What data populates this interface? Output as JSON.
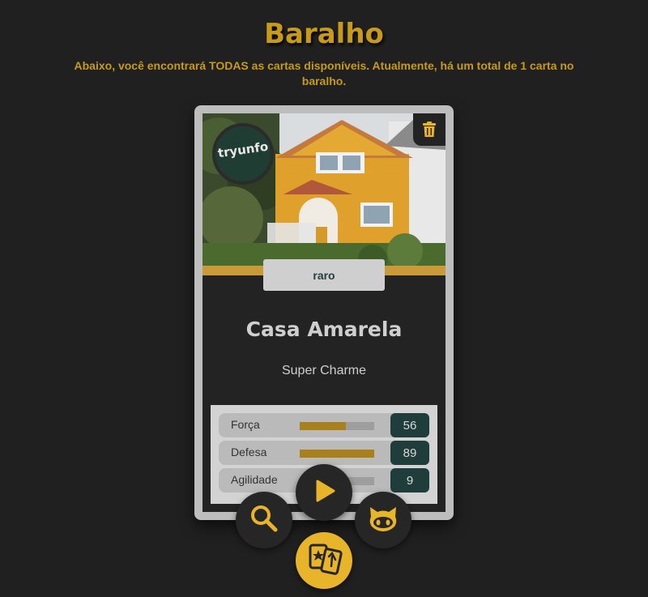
{
  "page": {
    "title": "Baralho",
    "subtitle": "Abaixo, você encontrará TODAS as cartas disponíveis. Atualmente, há um total de 1 carta no baralho."
  },
  "card": {
    "logo_text": "tryunfo",
    "rarity": "raro",
    "name": "Casa Amarela",
    "description": "Super Charme",
    "attributes": [
      {
        "label": "Força",
        "value": "56",
        "fill": 0.62
      },
      {
        "label": "Defesa",
        "value": "89",
        "fill": 1.0
      },
      {
        "label": "Agilidade",
        "value": "9",
        "fill": 0.1
      }
    ],
    "delete_icon": "trash-icon"
  },
  "nav": {
    "items": [
      {
        "icon": "search-icon"
      },
      {
        "icon": "play-icon"
      },
      {
        "icon": "github-icon"
      },
      {
        "icon": "cards-icon"
      }
    ]
  },
  "colors": {
    "background": "#202020",
    "accent": "#c89a1a",
    "fab_accent": "#e8b42a",
    "value_box": "#1f3d3a"
  }
}
